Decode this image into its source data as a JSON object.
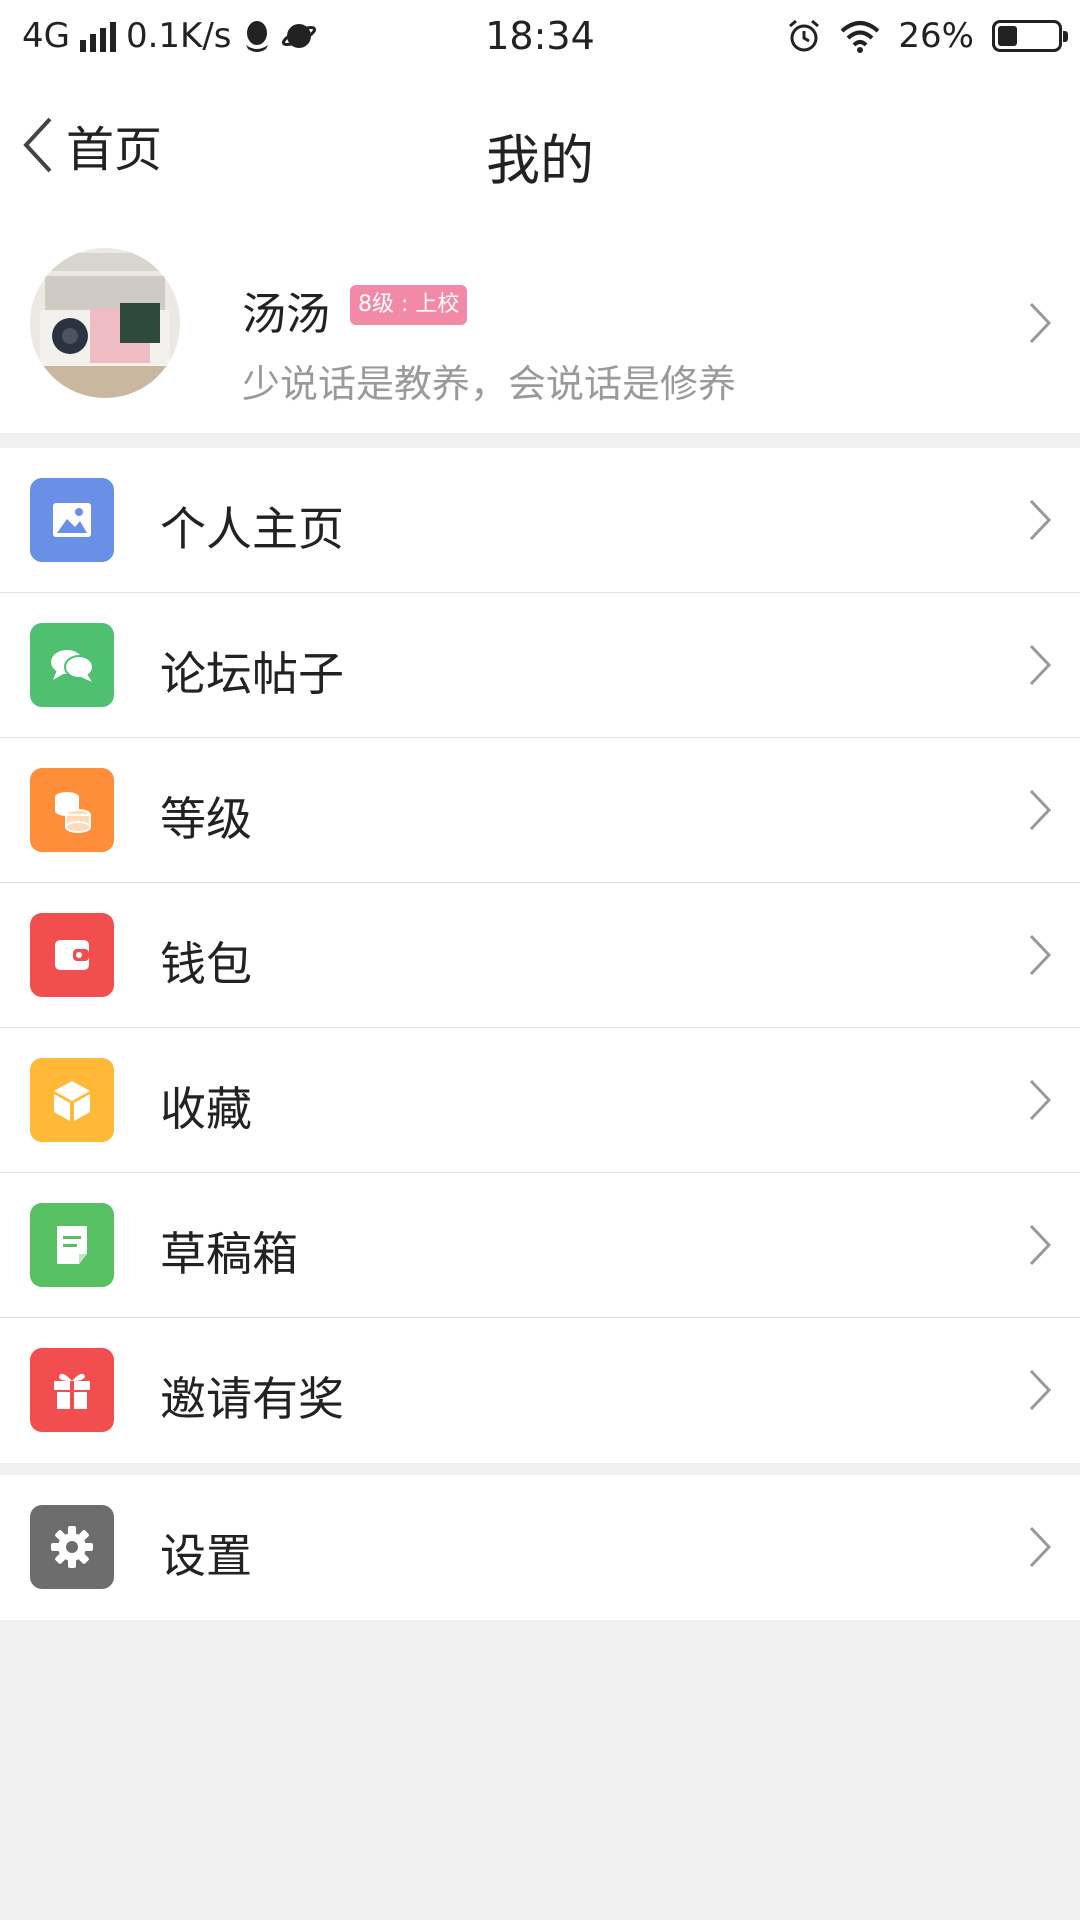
{
  "status_bar": {
    "network": "4G",
    "speed": "0.1K/s",
    "time": "18:34",
    "battery": "26%",
    "battery_level": 0.26
  },
  "nav": {
    "back_label": "首页",
    "title": "我的"
  },
  "profile": {
    "name": "汤汤",
    "level_badge": "8级 : 上校",
    "signature": "少说话是教养，会说话是修养"
  },
  "menu": [
    {
      "label": "个人主页",
      "icon": "image-icon",
      "color": "#6a8fe6"
    },
    {
      "label": "论坛帖子",
      "icon": "chat-bubbles-icon",
      "color": "#4fbf70"
    },
    {
      "label": "等级",
      "icon": "coins-icon",
      "color": "#ff8d3a"
    },
    {
      "label": "钱包",
      "icon": "wallet-icon",
      "color": "#f24e50"
    },
    {
      "label": "收藏",
      "icon": "box-icon",
      "color": "#ffb936"
    },
    {
      "label": "草稿箱",
      "icon": "draft-icon",
      "color": "#56c062"
    },
    {
      "label": "邀请有奖",
      "icon": "gift-icon",
      "color": "#f24e50"
    }
  ],
  "settings": {
    "label": "设置",
    "icon": "gear-icon",
    "color": "#6d6d6d"
  }
}
